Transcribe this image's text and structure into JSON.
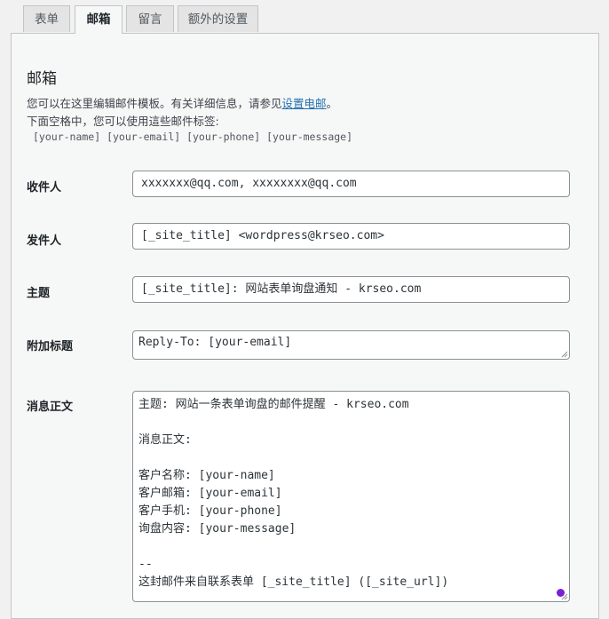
{
  "tabs": [
    {
      "label": "表单",
      "active": false
    },
    {
      "label": "邮箱",
      "active": true
    },
    {
      "label": "留言",
      "active": false
    },
    {
      "label": "额外的设置",
      "active": false
    }
  ],
  "section": {
    "title": "邮箱",
    "desc_line1_prefix": "您可以在这里编辑邮件模板。有关详细信息，请参见",
    "desc_line1_link": "设置电邮",
    "desc_line1_suffix": "。",
    "desc_line2": "下面空格中，您可以使用這些邮件标签:",
    "mail_tags": "[your-name] [your-email] [your-phone] [your-message]"
  },
  "fields": {
    "to": {
      "label": "收件人",
      "value": "xxxxxxx@qq.com, xxxxxxxx@qq.com"
    },
    "from": {
      "label": "发件人",
      "value": "[_site_title] <wordpress@krseo.com>"
    },
    "subject": {
      "label": "主题",
      "value": "[_site_title]: 网站表单询盘通知 - krseo.com"
    },
    "headers": {
      "label": "附加标题",
      "value": "Reply-To: [your-email]"
    },
    "body": {
      "label": "消息正文",
      "lines": [
        "主题: 网站一条表单询盘的邮件提醒 - krseo.com",
        "",
        "消息正文:",
        "",
        "客户名称: [your-name]",
        "客户邮箱: [your-email]",
        "客户手机: [your-phone]",
        "询盘内容: [your-message]",
        "",
        "--",
        "这封邮件来自联系表单 [_site_title] ([_site_url])"
      ]
    }
  },
  "colors": {
    "link": "#2271b1",
    "cursor_dot": "#7a1fd6"
  }
}
